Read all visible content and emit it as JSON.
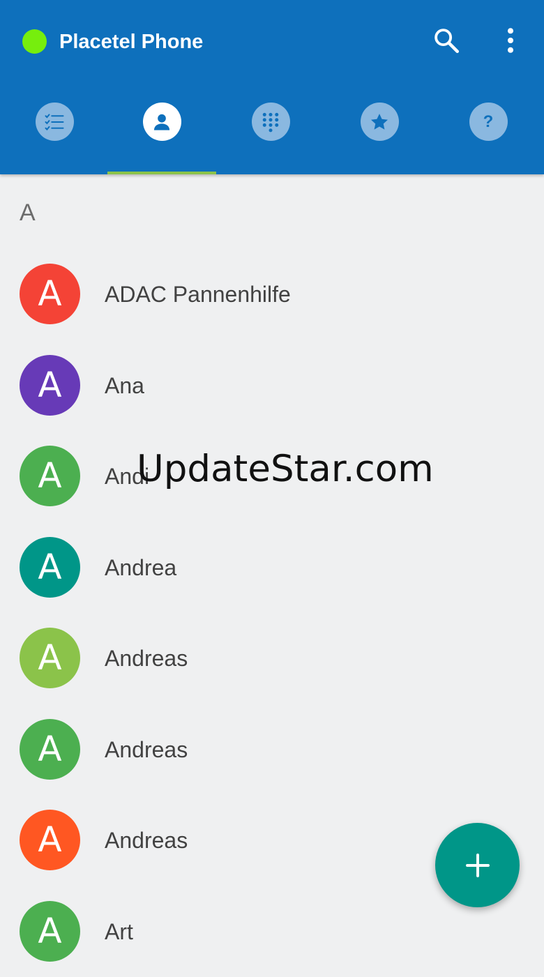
{
  "app": {
    "title": "Placetel Phone",
    "status_color": "#76ee0d",
    "bar_color": "#0e70bc"
  },
  "header_actions": {
    "search_icon": "search-icon",
    "overflow_icon": "more-vert-icon"
  },
  "tabs": [
    {
      "icon": "call-log-icon",
      "active": false
    },
    {
      "icon": "contacts-icon",
      "active": true
    },
    {
      "icon": "dialpad-icon",
      "active": false
    },
    {
      "icon": "star-icon",
      "active": false
    },
    {
      "icon": "help-icon",
      "label": "?",
      "active": false
    }
  ],
  "colors": {
    "tab_active_bg": "#ffffff",
    "tab_inactive_bg": "#8ab8e0",
    "tab_indicator": "#8bc34a",
    "fab": "#009688"
  },
  "contacts": {
    "section": "A",
    "items": [
      {
        "initial": "A",
        "name": "ADAC Pannenhilfe",
        "color": "#f44336"
      },
      {
        "initial": "A",
        "name": "Ana",
        "color": "#673ab7"
      },
      {
        "initial": "A",
        "name": "Andi",
        "color": "#4caf50"
      },
      {
        "initial": "A",
        "name": "Andrea",
        "color": "#009688"
      },
      {
        "initial": "A",
        "name": "Andreas",
        "color": "#8bc34a"
      },
      {
        "initial": "A",
        "name": "Andreas",
        "color": "#4caf50"
      },
      {
        "initial": "A",
        "name": "Andreas",
        "color": "#ff5722"
      },
      {
        "initial": "A",
        "name": "Art",
        "color": "#4caf50"
      }
    ]
  },
  "watermark": "UpdateStar.com",
  "fab": {
    "icon": "plus-icon"
  }
}
